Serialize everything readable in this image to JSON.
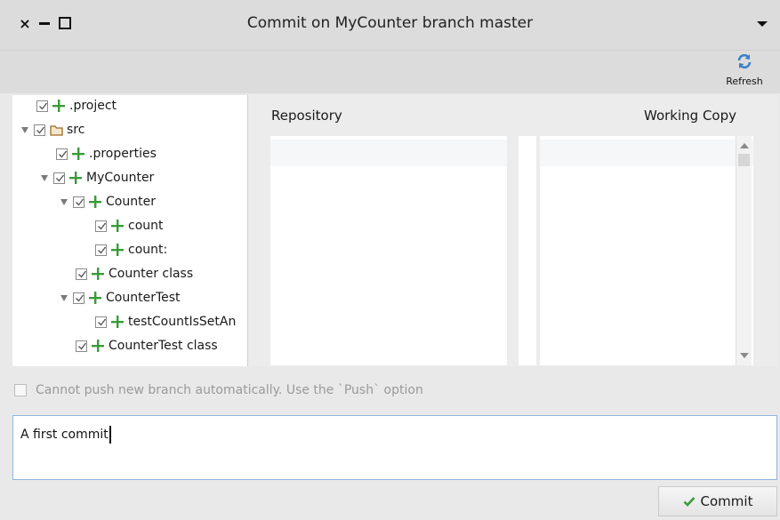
{
  "window": {
    "title": "Commit on MyCounter branch master",
    "close_glyph": "×"
  },
  "toolbar": {
    "refresh_label": "Refresh"
  },
  "tree": {
    "items": [
      {
        "label": ".project",
        "checked": true,
        "icon": "plus-icon"
      },
      {
        "label": "src",
        "checked": true,
        "icon": "folder-icon",
        "expanded": true
      },
      {
        "label": ".properties",
        "checked": true,
        "icon": "plus-icon"
      },
      {
        "label": "MyCounter",
        "checked": true,
        "icon": "plus-icon",
        "expanded": true
      },
      {
        "label": "Counter",
        "checked": true,
        "icon": "plus-icon",
        "expanded": true
      },
      {
        "label": "count",
        "checked": true,
        "icon": "plus-icon"
      },
      {
        "label": "count:",
        "checked": true,
        "icon": "plus-icon"
      },
      {
        "label": "Counter class",
        "checked": true,
        "icon": "plus-icon"
      },
      {
        "label": "CounterTest",
        "checked": true,
        "icon": "plus-icon",
        "expanded": true
      },
      {
        "label": "testCountIsSetAn",
        "checked": true,
        "icon": "plus-icon"
      },
      {
        "label": "CounterTest class",
        "checked": true,
        "icon": "plus-icon"
      }
    ]
  },
  "diff": {
    "left_header": "Repository",
    "right_header": "Working Copy"
  },
  "push": {
    "label": "Cannot push new branch automatically. Use the `Push` option",
    "checked": false
  },
  "message": {
    "text": "A first commit"
  },
  "commit": {
    "label": "Commit"
  },
  "colors": {
    "accent_green": "#3a9b3a",
    "refresh_blue": "#3a80c8",
    "folder_brown": "#9a6a2a"
  }
}
